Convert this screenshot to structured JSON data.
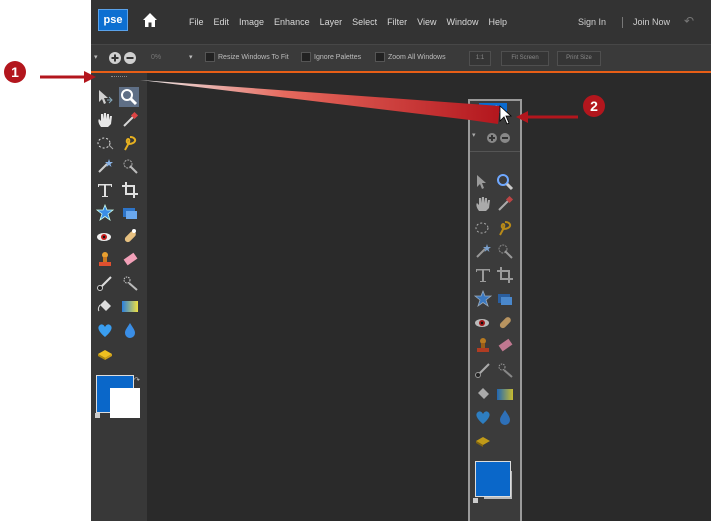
{
  "app": {
    "logo": "pse",
    "menus": [
      "File",
      "Edit",
      "Image",
      "Enhance",
      "Layer",
      "Select",
      "Filter",
      "View",
      "Window",
      "Help"
    ],
    "sign_in": "Sign In",
    "join_now": "Join Now"
  },
  "options_bar": {
    "zoom_percent": "0%",
    "resize_windows": "Resize Windows To Fit",
    "ignore_palettes": "Ignore Palettes",
    "zoom_all_windows": "Zoom All Windows",
    "one_to_one": "1:1",
    "fit_screen": "Fit Screen",
    "print_size": "Print Size"
  },
  "floating_panel": {
    "title": "pse"
  },
  "callouts": {
    "one": "1",
    "two": "2"
  },
  "colors": {
    "accent": "#e85e16",
    "brand": "#0d6fd1",
    "callout": "#b3161d",
    "foreground_swatch": "#0a67c9"
  }
}
